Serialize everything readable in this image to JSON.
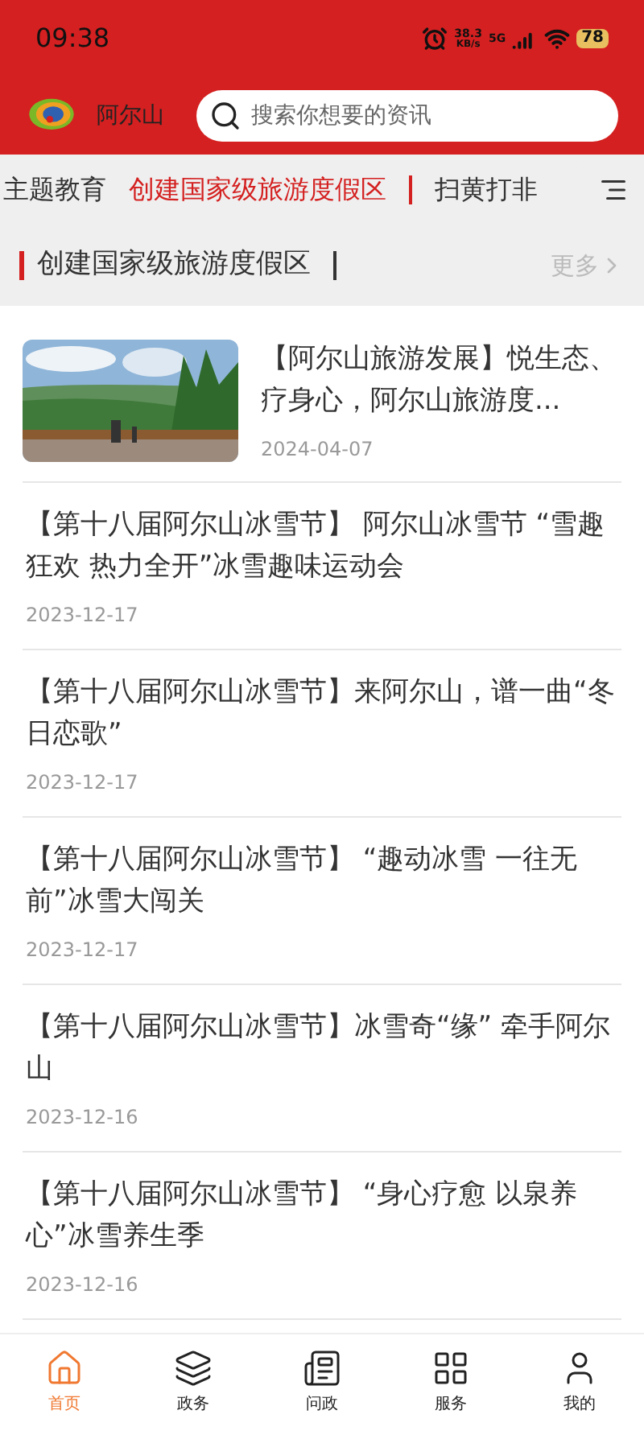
{
  "status_bar": {
    "time": "09:38",
    "speed_value": "38.3",
    "speed_unit": "KB/s",
    "network": "5G",
    "battery": "78"
  },
  "header": {
    "app_name": "阿尔山",
    "search": {
      "placeholder": "搜索你想要的资讯"
    }
  },
  "tabs": [
    {
      "label": "主题教育",
      "selected": false
    },
    {
      "label": "创建国家级旅游度假区",
      "selected": true
    },
    {
      "label": "扫黄打非",
      "selected": false
    }
  ],
  "section": {
    "title": "创建国家级旅游度假区",
    "more": "更多"
  },
  "articles": [
    {
      "title": "【阿尔山旅游发展】悦生态、疗身心，阿尔山旅游度...",
      "date": "2024-04-07"
    },
    {
      "kind": "text",
      "title": "【第十八届阿尔山冰雪节】  阿尔山冰雪节 “雪趣狂欢 热力全开”冰雪趣味运动会",
      "date": "2023-12-17"
    },
    {
      "kind": "text",
      "title": "【第十八届阿尔山冰雪节】来阿尔山，谱一曲“冬日恋歌”",
      "date": "2023-12-17"
    },
    {
      "kind": "text",
      "title": "【第十八届阿尔山冰雪节】 “趣动冰雪 一往无前”冰雪大闯关",
      "date": "2023-12-17"
    },
    {
      "kind": "text",
      "title": "【第十八届阿尔山冰雪节】冰雪奇“缘” 牵手阿尔山",
      "date": "2023-12-16"
    },
    {
      "kind": "text",
      "title": "【第十八届阿尔山冰雪节】 “身心疗愈 以泉养心”冰雪养生季",
      "date": "2023-12-16"
    }
  ],
  "bottom_nav": [
    {
      "label": "首页",
      "kind": "home",
      "selected": true
    },
    {
      "label": "政务",
      "kind": "layers",
      "selected": false
    },
    {
      "label": "问政",
      "kind": "newspaper",
      "selected": false
    },
    {
      "label": "服务",
      "kind": "grid",
      "selected": false
    },
    {
      "label": "我的",
      "kind": "user",
      "selected": false
    }
  ]
}
